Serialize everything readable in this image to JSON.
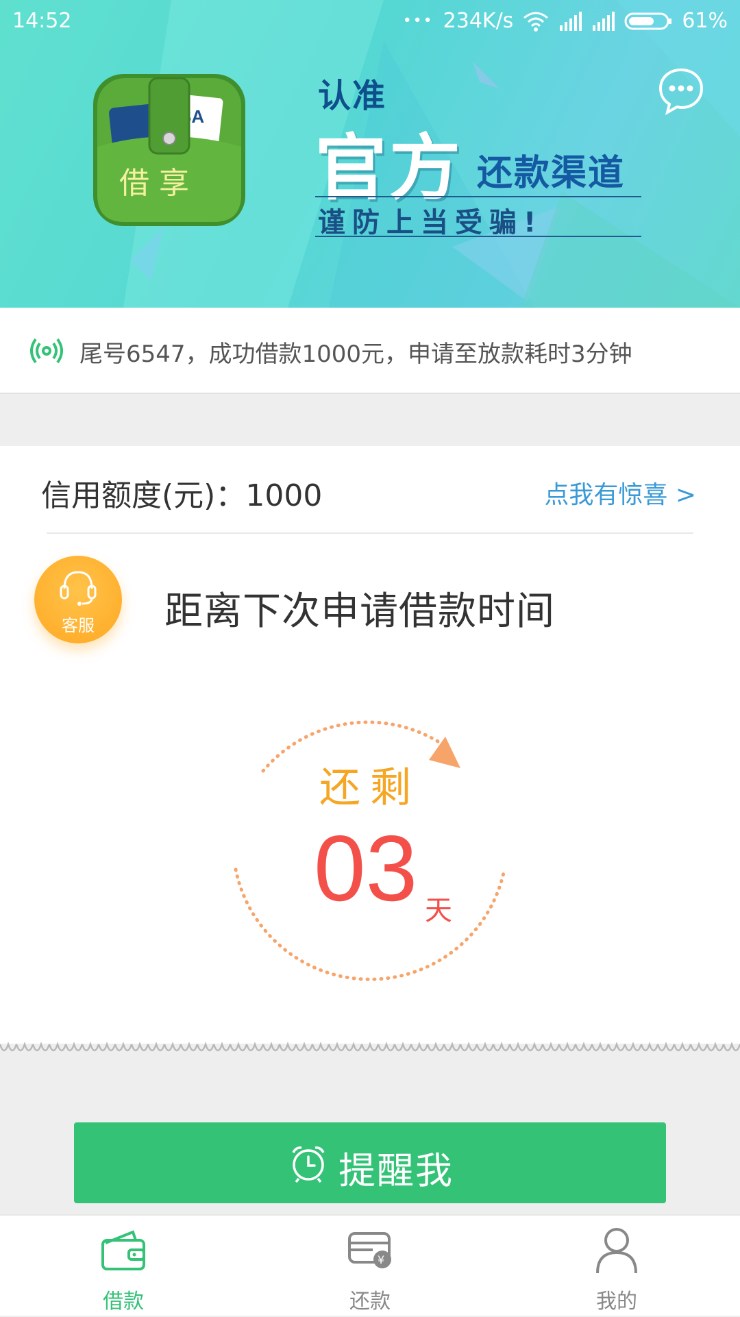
{
  "status_bar": {
    "time": "14:52",
    "dots": "•••",
    "speed": "234K/s",
    "battery": "61%"
  },
  "banner": {
    "logo_text": "借 享",
    "slogan_line1": "认准",
    "slogan_big": "官方",
    "slogan_small": "还款渠道",
    "slogan_warning": "谨防上当受骗!",
    "chat_icon": "chat-bubble-icon"
  },
  "notice": {
    "icon": "broadcast-icon",
    "text": "尾号6547，成功借款1000元，申请至放款耗时3分钟"
  },
  "credit": {
    "label": "信用额度(元)：",
    "value": "1000",
    "surprise_link": "点我有惊喜 >"
  },
  "customer_service": {
    "label": "客服",
    "icon": "headset-icon"
  },
  "countdown": {
    "title": "距离下次申请借款时间",
    "remaining_label": "还剩",
    "days": "03",
    "unit": "天"
  },
  "remind_button": {
    "label": "提醒我",
    "icon": "alarm-clock-icon"
  },
  "tabs": [
    {
      "label": "借款",
      "icon": "wallet-icon",
      "active": true
    },
    {
      "label": "还款",
      "icon": "repay-card-icon",
      "active": false
    },
    {
      "label": "我的",
      "icon": "user-icon",
      "active": false
    }
  ],
  "colors": {
    "brand_green": "#34c277",
    "banner_teal": "#55d7d4",
    "accent_orange": "#f5a623",
    "count_red": "#f4504a",
    "link_blue": "#3a9ad6"
  }
}
